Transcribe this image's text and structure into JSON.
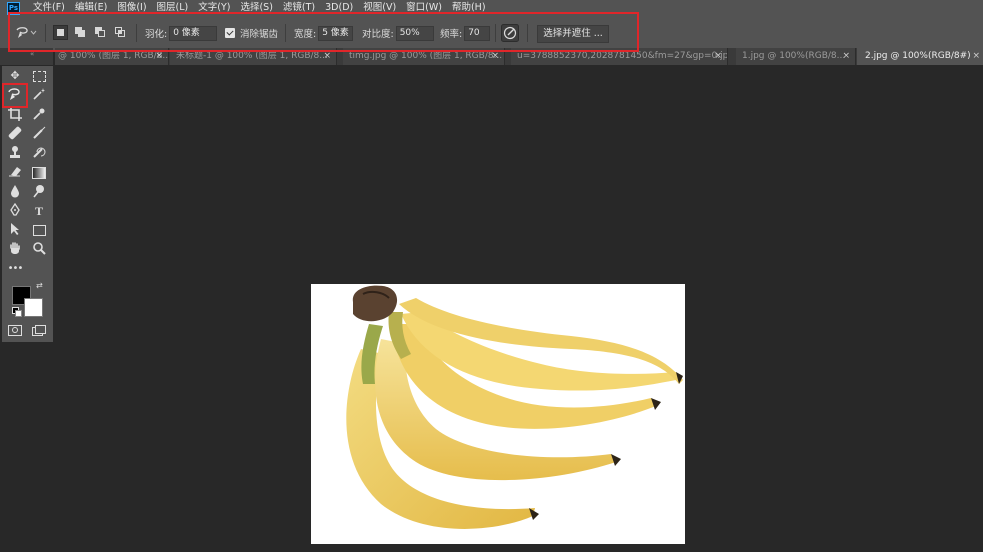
{
  "app": {
    "logo_text": "Ps"
  },
  "menu": [
    "文件(F)",
    "编辑(E)",
    "图像(I)",
    "图层(L)",
    "文字(Y)",
    "选择(S)",
    "滤镜(T)",
    "3D(D)",
    "视图(V)",
    "窗口(W)",
    "帮助(H)"
  ],
  "options_bar": {
    "feather_label": "羽化:",
    "feather_value": "0 像素",
    "antialias_label": "消除锯齿",
    "width_label": "宽度:",
    "width_value": "5 像素",
    "contrast_label": "对比度:",
    "contrast_value": "50%",
    "frequency_label": "频率:",
    "frequency_value": "70",
    "select_mask_label": "选择并遮住 ..."
  },
  "tabs": [
    {
      "label": "@ 100% (图层 1, RGB/8...",
      "active": false
    },
    {
      "label": "未标题-1 @ 100% (图层 1, RGB/8...",
      "active": false
    },
    {
      "label": "timg.jpg @ 100% (图层 1, RGB/8...",
      "active": false
    },
    {
      "label": "u=3788852370,2028781450&fm=27&gp=0.jpg",
      "active": false
    },
    {
      "label": "1.jpg @ 100%(RGB/8...",
      "active": false
    },
    {
      "label": "2.jpg @ 100%(RGB/8#)",
      "active": true
    }
  ],
  "tab_close_glyph": "×",
  "colors": {
    "highlight": "#e0262a",
    "foreground": "#000000",
    "background": "#ffffff"
  }
}
